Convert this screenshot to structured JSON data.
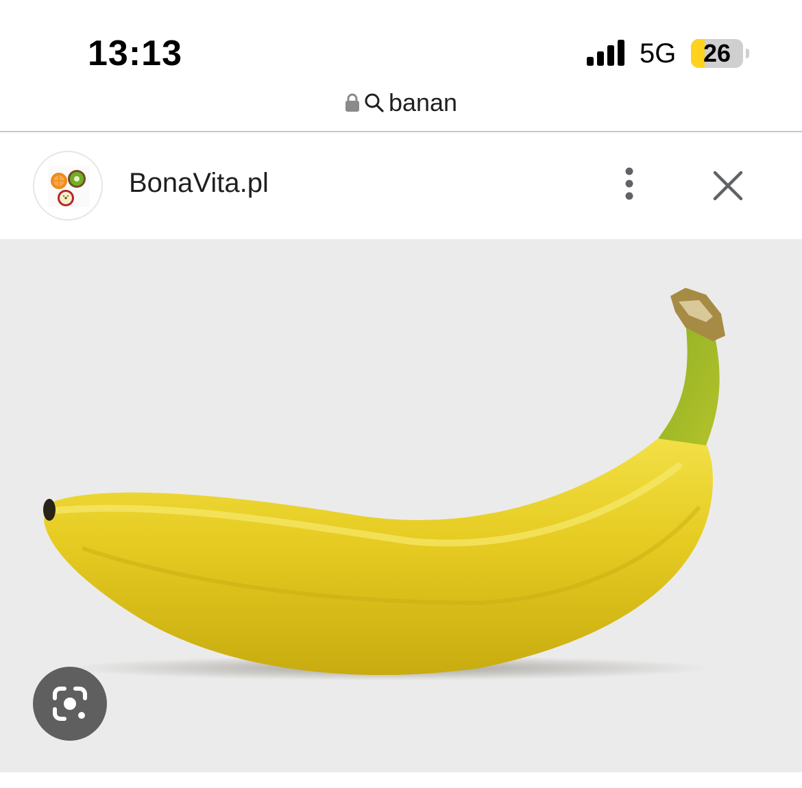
{
  "status_bar": {
    "time": "13:13",
    "network": "5G",
    "battery_level": "26",
    "battery_fraction": 0.26,
    "battery_color": "#ffd21f",
    "signal_icon": "cellular-signal-icon"
  },
  "url_bar": {
    "lock_icon": "lock-icon",
    "search_icon": "search-icon",
    "query": "banan"
  },
  "source": {
    "name": "BonaVita.pl",
    "logo": "bonavita-logo",
    "more_icon": "more-vertical-icon",
    "close_icon": "close-icon"
  },
  "image": {
    "subject": "banana",
    "background_color": "#ebebeb"
  },
  "lens_button": {
    "icon": "google-lens-icon"
  }
}
